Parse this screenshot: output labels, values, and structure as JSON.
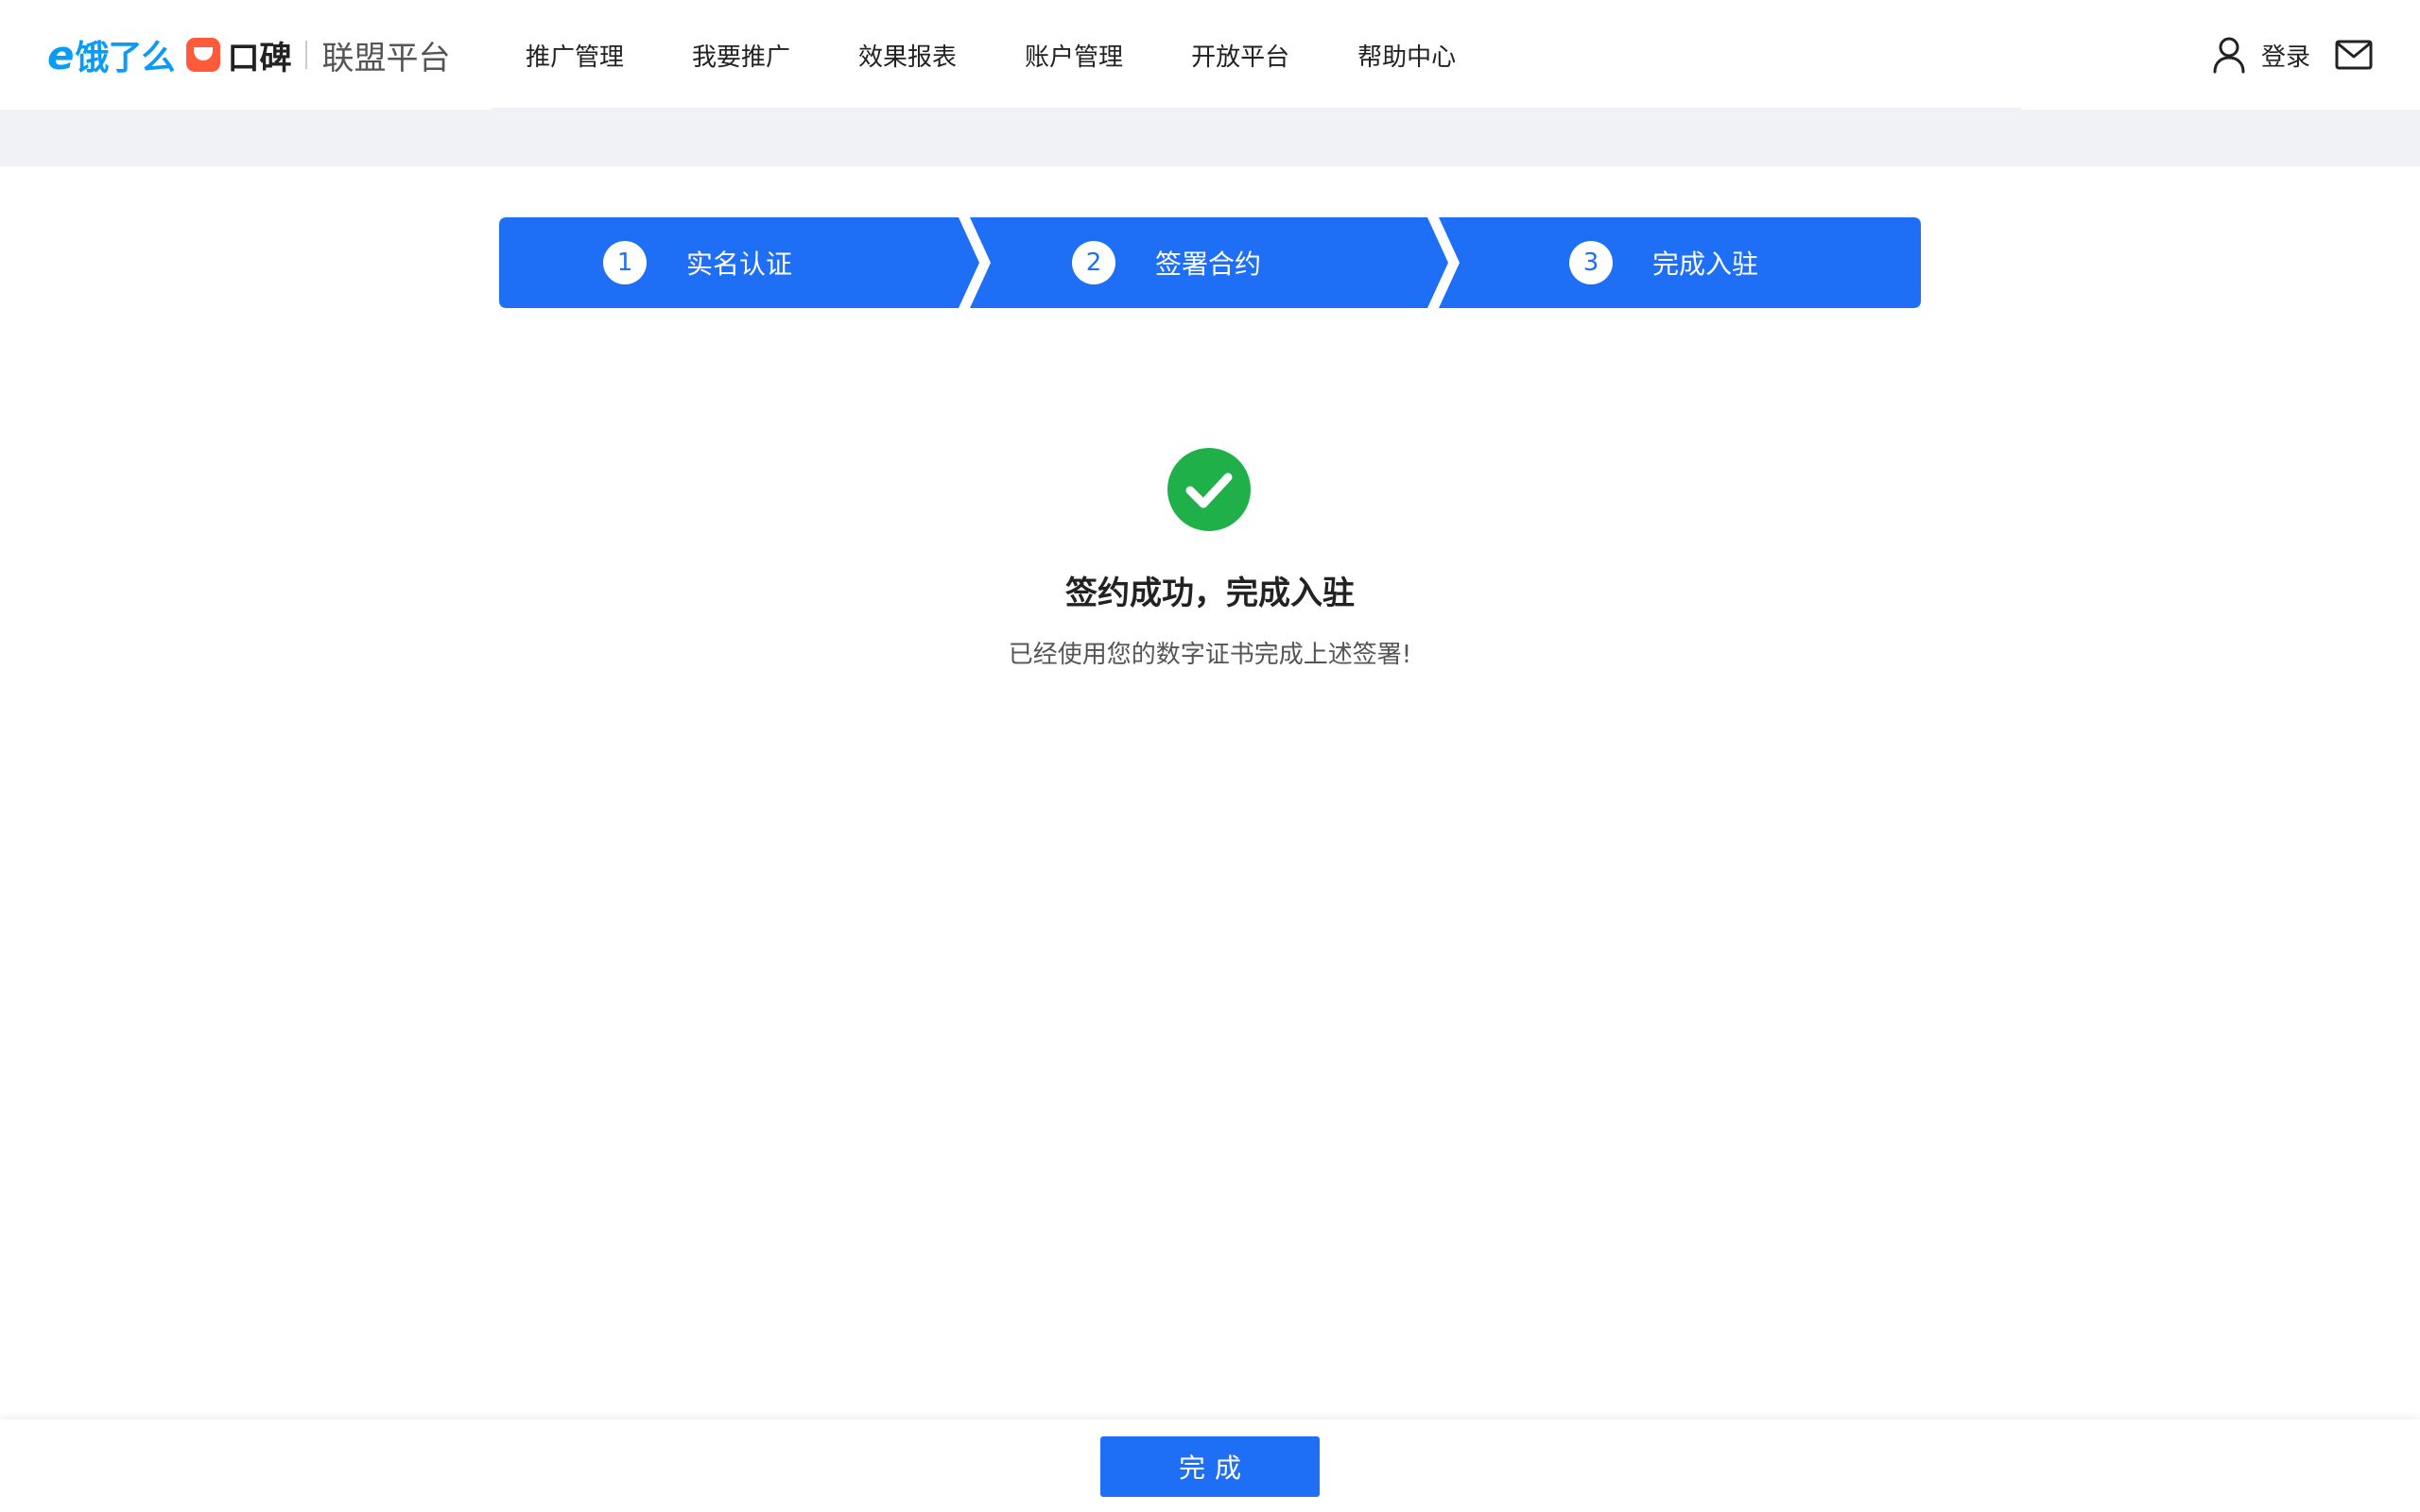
{
  "colors": {
    "primary": "#1f6ff6",
    "success": "#1fb04a",
    "logo_blue": "#0a9bf5",
    "koubei_red": "#ff5a39",
    "band_gray": "#f0f2f5"
  },
  "header": {
    "logo": {
      "eleme_mark": "e",
      "eleme_text": "饿了么",
      "koubei_text": "口碑",
      "platform_text": "联盟平台"
    },
    "nav": [
      {
        "label": "推广管理"
      },
      {
        "label": "我要推广"
      },
      {
        "label": "效果报表"
      },
      {
        "label": "账户管理"
      },
      {
        "label": "开放平台"
      },
      {
        "label": "帮助中心"
      }
    ],
    "login_label": "登录",
    "icons": {
      "user": "user-icon",
      "mail": "mail-icon"
    }
  },
  "steps": [
    {
      "number": "1",
      "label": "实名认证"
    },
    {
      "number": "2",
      "label": "签署合约"
    },
    {
      "number": "3",
      "label": "完成入驻"
    }
  ],
  "result": {
    "icon": "check-circle-icon",
    "title": "签约成功，完成入驻",
    "description": "已经使用您的数字证书完成上述签署!"
  },
  "footer": {
    "done_label": "完成"
  }
}
